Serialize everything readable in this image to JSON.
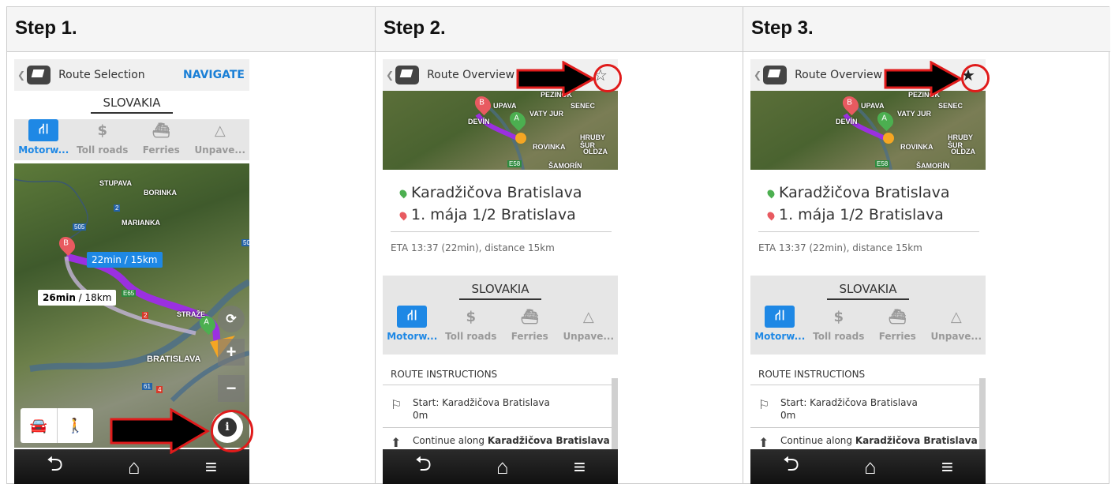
{
  "steps": [
    {
      "title": "Step 1."
    },
    {
      "title": "Step 2."
    },
    {
      "title": "Step 3."
    }
  ],
  "screen1": {
    "title": "Route Selection",
    "navigate": "NAVIGATE",
    "country": "SLOVAKIA",
    "tabs": [
      "Motorw...",
      "Toll roads",
      "Ferries",
      "Unpave..."
    ],
    "route_a_time": "22min",
    "route_a_dist": " / 15km",
    "route_b_time": "26min",
    "route_b_dist": " / 18km",
    "towns": [
      "STUPAVA",
      "BORINKA",
      "MARIANKA",
      "BRATISLAVA",
      "STRAŽE"
    ],
    "roads": [
      "2",
      "505",
      "E65",
      "2",
      "61",
      "4",
      "50"
    ],
    "pin_b": "B",
    "pin_a": "A"
  },
  "screen2": {
    "title": "Route Overview",
    "origin": "Karadžičova  Bratislava",
    "destination": "1. mája 1/2  Bratislava",
    "eta": "ETA 13:37 (22min), distance 15km",
    "country": "SLOVAKIA",
    "tabs": [
      "Motorw...",
      "Toll roads",
      "Ferries",
      "Unpave..."
    ],
    "section": "ROUTE INSTRUCTIONS",
    "instr1_text": "Start: Karadžičova Bratislava",
    "instr1_dist": "0m",
    "instr2_prefix": "Continue along ",
    "instr2_bold": "Karadžičova Bratislava",
    "map_labels": [
      "UPAVA",
      "SENEC",
      "PEZINOK",
      "DEVÍN",
      "VATY JUR",
      "HRUBY ŠUR",
      "ROVINKA",
      "OLDZA",
      "ŠAMORÍN",
      "E58"
    ]
  },
  "screen3": {
    "title": "Route Overview",
    "origin": "Karadžičova  Bratislava",
    "destination": "1. mája 1/2  Bratislava",
    "eta": "ETA 13:37 (22min), distance 15km",
    "country": "SLOVAKIA",
    "tabs": [
      "Motorw...",
      "Toll roads",
      "Ferries",
      "Unpave..."
    ],
    "section": "ROUTE INSTRUCTIONS",
    "instr1_text": "Start: Karadžičova Bratislava",
    "instr1_dist": "0m",
    "instr2_prefix": "Continue along ",
    "instr2_bold": "Karadžičova Bratislava",
    "map_labels": [
      "UPAVA",
      "SENEC",
      "PEZINOK",
      "DEVÍN",
      "VATY JUR",
      "HRUBY ŠUR",
      "ROVINKA",
      "OLDZA",
      "ŠAMORÍN",
      "E58"
    ]
  },
  "icons": {
    "star_empty": "star-outline-icon",
    "star_filled": "star-filled-icon",
    "info": "info-icon",
    "car": "car-icon",
    "walk": "walk-icon",
    "back": "back-icon",
    "home": "home-icon",
    "menu": "menu-icon"
  },
  "colors": {
    "accent": "#1e88e5",
    "highlight": "#e01b1b",
    "route": "#9b30e0"
  }
}
